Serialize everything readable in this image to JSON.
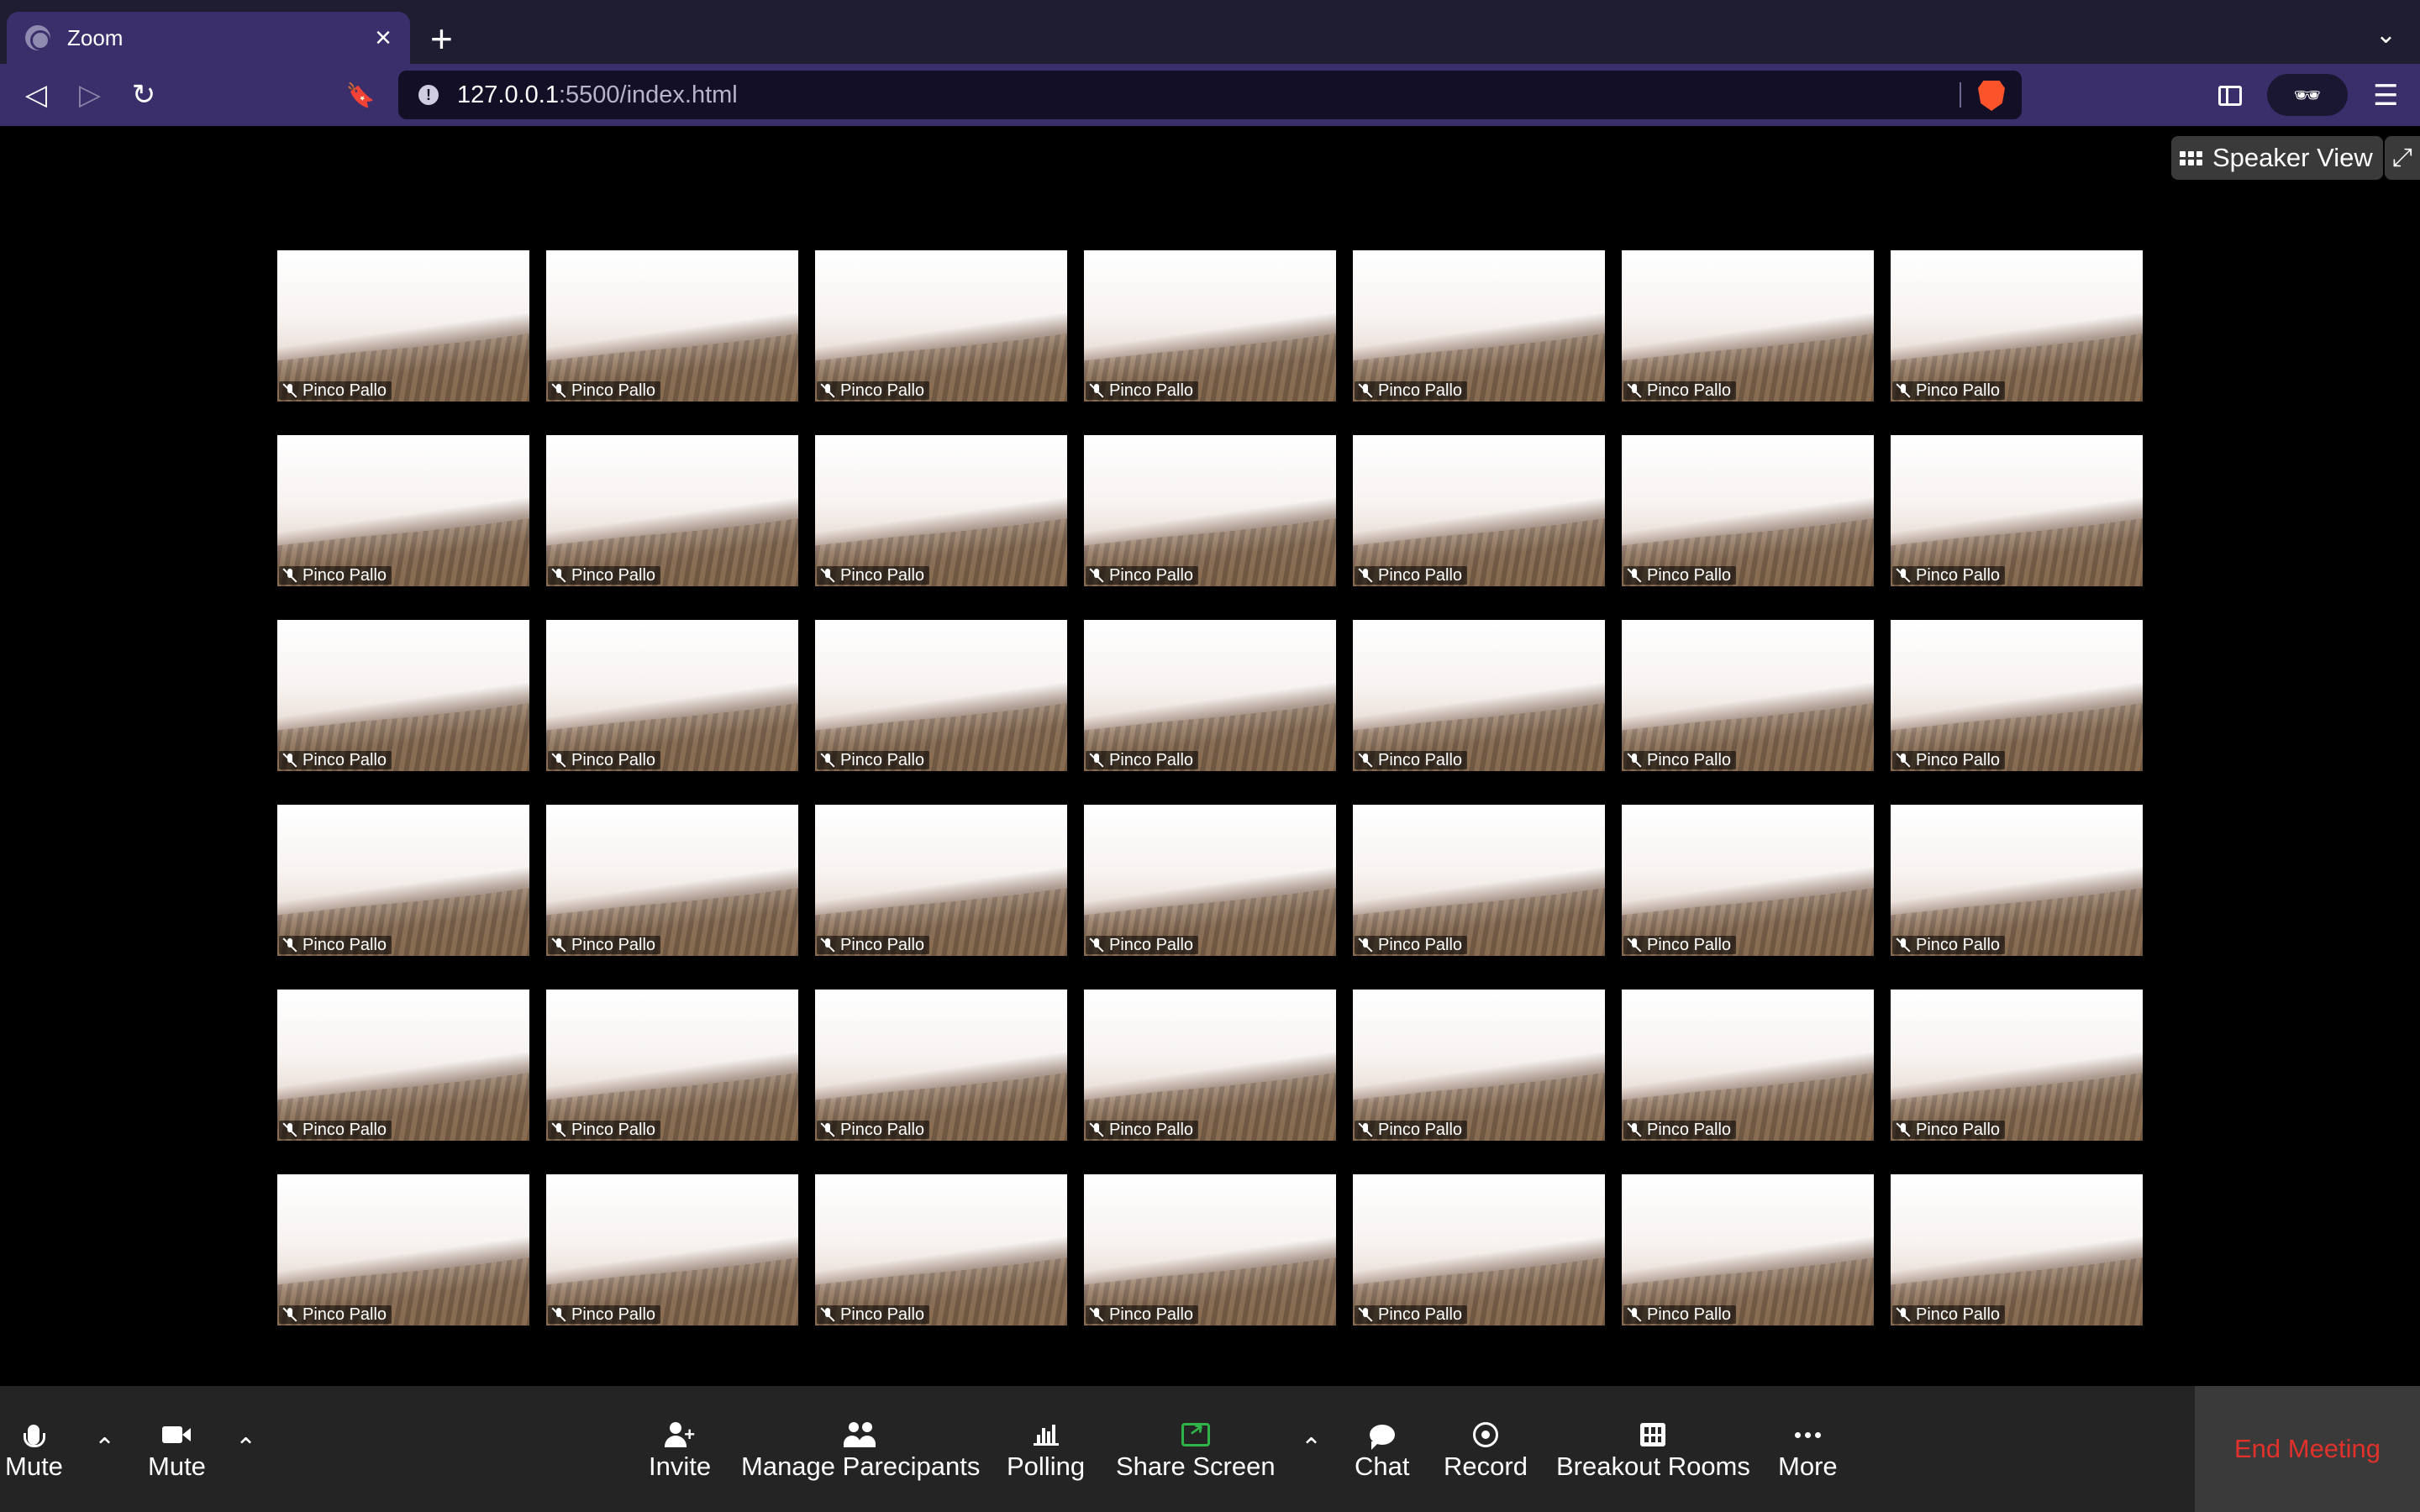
{
  "browser": {
    "tab_title": "Zoom",
    "tab_close": "×",
    "new_tab": "+",
    "tab_dropdown": "⌄",
    "url_host": "127.0.0.1",
    "url_rest": ":5500/index.html",
    "back_icon": "◁",
    "forward_icon": "▷",
    "reload_icon": "↻",
    "bookmark_icon": "🔖",
    "menu_icon": "☰",
    "glasses_icon": "🕶"
  },
  "view": {
    "speaker_view_label": "Speaker View",
    "fullscreen_icon": "⤢"
  },
  "gallery": {
    "rows": 6,
    "columns": 7,
    "participant_name": "Pinco Pallo"
  },
  "controls": {
    "audio_label": "Mute",
    "video_label": "Mute",
    "caret": "⌃",
    "invite_label": "Invite",
    "manage_label": "Manage Parecipants",
    "polling_label": "Polling",
    "share_label": "Share Screen",
    "chat_label": "Chat",
    "record_label": "Record",
    "breakout_label": "Breakout Rooms",
    "more_label": "More",
    "end_label": "End Meeting"
  },
  "colors": {
    "share_accent": "#2fb44a",
    "end_meeting": "#e0322b",
    "browser_accent": "#3a2f6b"
  }
}
